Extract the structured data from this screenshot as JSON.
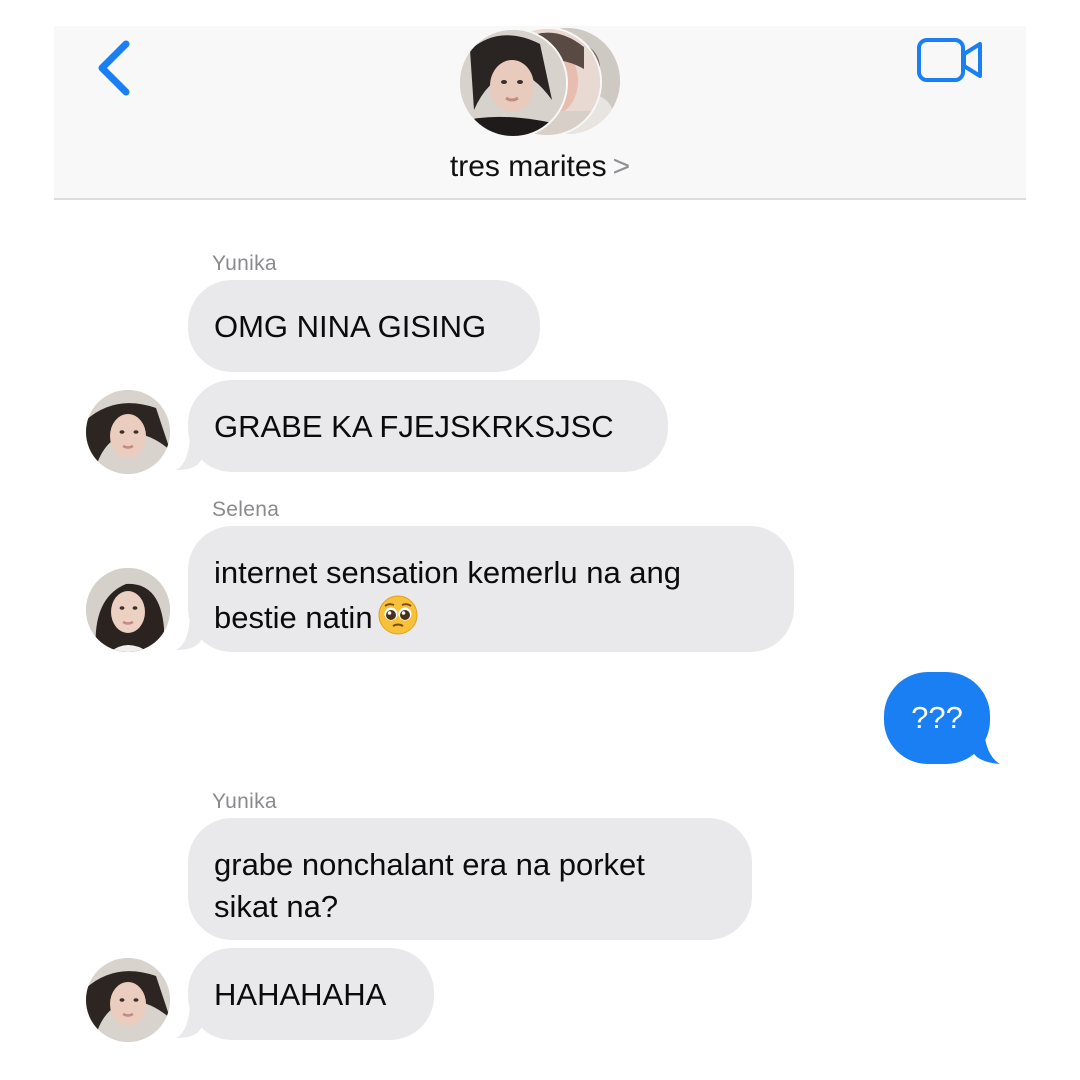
{
  "header": {
    "title": "tres marites",
    "title_chevron": ">",
    "back_icon": "chevron-left-icon",
    "video_icon": "video-camera-icon"
  },
  "colors": {
    "accent": "#1a7ff2",
    "incoming_bubble": "#e9e9eb",
    "header_bg": "#f8f8f9"
  },
  "messages": [
    {
      "sender": "Yunika",
      "text": "OMG NINA GISING",
      "direction": "incoming"
    },
    {
      "sender": "",
      "text": "GRABE KA FJEJSKRKSJSC",
      "direction": "incoming"
    },
    {
      "sender": "Selena",
      "text": "internet sensation kemerlu na ang\nbestie natin",
      "emoji": "pleading-face-emoji",
      "direction": "incoming"
    },
    {
      "sender": "",
      "text": "???",
      "direction": "outgoing"
    },
    {
      "sender": "Yunika",
      "text": "grabe nonchalant era na porket\nsikat na?",
      "direction": "incoming"
    },
    {
      "sender": "",
      "text": "HAHAHAHA",
      "direction": "incoming"
    }
  ]
}
